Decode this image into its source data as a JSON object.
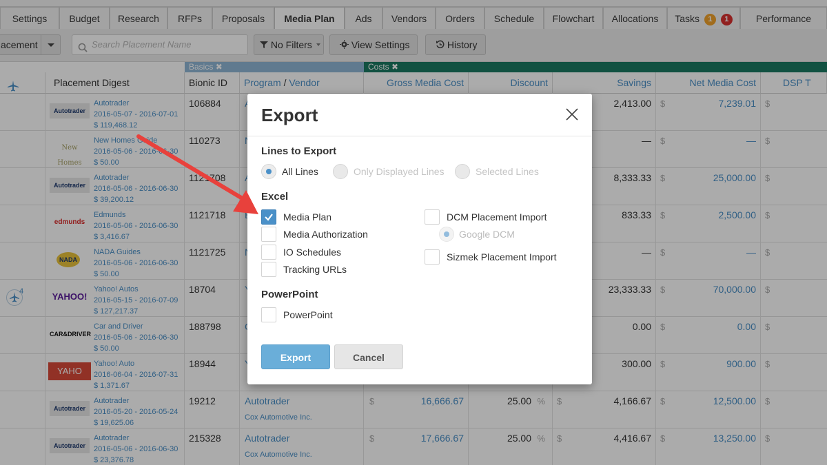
{
  "tabs": [
    {
      "label": "Settings"
    },
    {
      "label": "Budget"
    },
    {
      "label": "Research"
    },
    {
      "label": "RFPs"
    },
    {
      "label": "Proposals"
    },
    {
      "label": "Media Plan"
    },
    {
      "label": "Ads"
    },
    {
      "label": "Vendors"
    },
    {
      "label": "Orders"
    },
    {
      "label": "Schedule"
    },
    {
      "label": "Flowchart"
    },
    {
      "label": "Allocations"
    },
    {
      "label": "Tasks"
    },
    {
      "label": "Performance"
    }
  ],
  "tasks_badges": {
    "warning_count": "1",
    "alert_count": "1",
    "warning_color": "#f0a12b",
    "alert_color": "#d9302f"
  },
  "toolbar": {
    "group_select": "acement",
    "search_placeholder": "Search Placement Name",
    "filters_label": "No Filters",
    "view_settings_label": "View Settings",
    "history_label": "History"
  },
  "group_headers": {
    "basics": "Basics",
    "costs": "Costs",
    "basics_color": "#8fb7d6",
    "costs_color": "#1a7a62"
  },
  "columns": {
    "digest": "Placement Digest",
    "bionic_id": "Bionic ID",
    "program": "Program",
    "vendor": "Vendor",
    "gross": "Gross Media Cost",
    "discount": "Discount",
    "savings": "Savings",
    "net": "Net Media Cost",
    "dsp": "DSP T"
  },
  "rows": [
    {
      "logo": "Autotrader",
      "name": "Autotrader",
      "dates": "2016-05-07 - 2016-07-01",
      "amount": "$ 119,468.12",
      "id": "106884",
      "program": "A",
      "vendor": "",
      "gross": "",
      "discount": "",
      "savings": "2,413.00",
      "net": "7,239.01"
    },
    {
      "logo": "New Homes",
      "name": "New Homes Guide",
      "dates": "2016-05-06 - 2016-06-30",
      "amount": "$ 50.00",
      "id": "110273",
      "program": "N",
      "vendor": "",
      "gross": "",
      "discount": "",
      "savings": "—",
      "net": "—"
    },
    {
      "logo": "Autotrader",
      "name": "Autotrader",
      "dates": "2016-05-06 - 2016-06-30",
      "amount": "$ 39,200.12",
      "id": "1121708",
      "program": "A",
      "vendor": "",
      "gross": "",
      "discount": "",
      "savings": "8,333.33",
      "net": "25,000.00"
    },
    {
      "logo": "edmunds",
      "name": "Edmunds",
      "dates": "2016-05-06 - 2016-06-30",
      "amount": "$ 3,416.67",
      "id": "1121718",
      "program": "E",
      "vendor": "",
      "gross": "",
      "discount": "",
      "savings": "833.33",
      "net": "2,500.00"
    },
    {
      "logo": "NADA",
      "name": "NADA Guides",
      "dates": "2016-05-06 - 2016-06-30",
      "amount": "$ 50.00",
      "id": "1121725",
      "program": "N",
      "vendor": "",
      "gross": "",
      "discount": "",
      "savings": "—",
      "net": "—"
    },
    {
      "logo": "YAHOO!",
      "name": "Yahoo! Autos",
      "dates": "2016-05-15 - 2016-07-09",
      "amount": "$ 127,217.37",
      "id": "18704",
      "program": "Y",
      "vendor": "",
      "gross": "",
      "discount": "",
      "savings": "23,333.33",
      "net": "70,000.00"
    },
    {
      "logo": "CAR&DRIVER",
      "name": "Car and Driver",
      "dates": "2016-05-06 - 2016-06-30",
      "amount": "$ 50.00",
      "id": "188798",
      "program": "C",
      "vendor": "",
      "gross": "",
      "discount": "",
      "savings": "0.00",
      "net": "0.00"
    },
    {
      "logo": "YAHO",
      "name": "Yahoo! Auto",
      "dates": "2016-06-04 - 2016-07-31",
      "amount": "$ 1,371.67",
      "id": "18944",
      "program": "Y",
      "vendor": "",
      "gross": "",
      "discount": "",
      "savings": "300.00",
      "net": "900.00"
    },
    {
      "logo": "Autotrader",
      "name": "Autotrader",
      "dates": "2016-05-20 - 2016-05-24",
      "amount": "$ 19,625.06",
      "id": "19212",
      "program": "Autotrader",
      "vendor": "Cox Automotive Inc.",
      "gross": "16,666.67",
      "discount": "25.00",
      "savings": "4,166.67",
      "net": "12,500.00"
    },
    {
      "logo": "Autotrader",
      "name": "Autotrader",
      "dates": "2016-05-06 - 2016-06-30",
      "amount": "$ 23,376.78",
      "id": "215328",
      "program": "Autotrader",
      "vendor": "Cox Automotive Inc.",
      "gross": "17,666.67",
      "discount": "25.00",
      "savings": "4,416.67",
      "net": "13,250.00"
    }
  ],
  "plane_count": "4",
  "modal": {
    "title": "Export",
    "lines_heading": "Lines to Export",
    "lines_options": [
      "All Lines",
      "Only Displayed Lines",
      "Selected Lines"
    ],
    "lines_selected": "All Lines",
    "excel_heading": "Excel",
    "excel_left": [
      {
        "label": "Media Plan",
        "checked": true
      },
      {
        "label": "Media Authorization",
        "checked": false
      },
      {
        "label": "IO Schedules",
        "checked": false
      },
      {
        "label": "Tracking URLs",
        "checked": false
      }
    ],
    "excel_right": [
      {
        "label": "DCM Placement Import",
        "checked": false
      },
      {
        "label": "Sizmek Placement Import",
        "checked": false
      }
    ],
    "google_dcm_label": "Google DCM",
    "ppt_heading": "PowerPoint",
    "ppt_label": "PowerPoint",
    "export_button": "Export",
    "cancel_button": "Cancel"
  },
  "accent_color": "#4a90c8",
  "annotation_arrow_color": "#e8413c"
}
